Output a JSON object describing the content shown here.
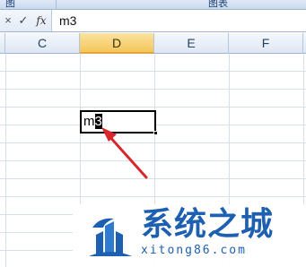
{
  "ribbon": {
    "group_left": "图",
    "group_right": "图表"
  },
  "formula_bar": {
    "cancel_icon": "×",
    "enter_icon": "✓",
    "function_icon": "fx",
    "value": "m3"
  },
  "columns": [
    {
      "label": "C",
      "active": false
    },
    {
      "label": "D",
      "active": true
    },
    {
      "label": "E",
      "active": false
    },
    {
      "label": "F",
      "active": false
    }
  ],
  "active_cell": {
    "text_before_caret": "m",
    "caret_char": "3"
  },
  "annotation": {
    "arrow_color": "#d9262a"
  },
  "watermark": {
    "title": "系统之城",
    "url": "xitong86.com",
    "color": "#1d5fb0"
  }
}
